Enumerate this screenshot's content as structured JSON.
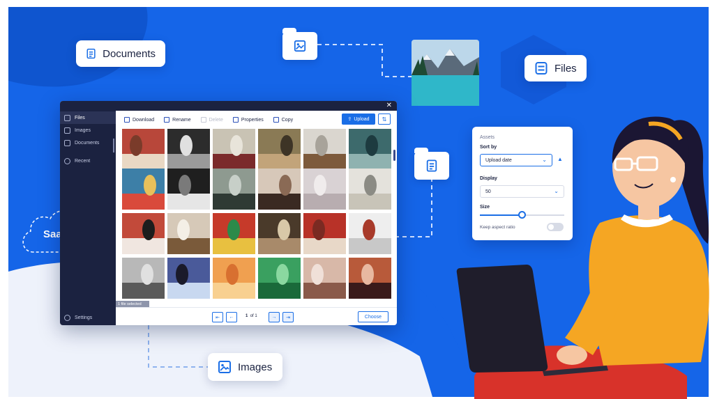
{
  "chips": {
    "documents_label": "Documents",
    "files_label": "Files",
    "images_label": "Images",
    "saas_label": "SaaS"
  },
  "window": {
    "close_glyph": "✕",
    "sidebar": {
      "items": [
        {
          "label": "Files",
          "icon": "file-list-icon"
        },
        {
          "label": "Images",
          "icon": "image-icon"
        },
        {
          "label": "Documents",
          "icon": "document-icon"
        },
        {
          "label": "Recent",
          "icon": "clock-icon"
        }
      ],
      "settings_label": "Settings"
    },
    "toolbar": {
      "download_label": "Download",
      "rename_label": "Rename",
      "delete_label": "Delete",
      "properties_label": "Properties",
      "copy_label": "Copy",
      "upload_label": "Upload"
    },
    "status": "1 file selected",
    "pagination": {
      "current_page": "1",
      "of_label": "of 1"
    },
    "choose_label": "Choose"
  },
  "assets_panel": {
    "title": "Assets",
    "sort_by_label": "Sort by",
    "sort_by_value": "Upload date",
    "display_label": "Display",
    "display_value": "50",
    "size_label": "Size",
    "size_value": 0.5,
    "aspect_label": "Keep aspect ratio",
    "aspect_on": false
  },
  "colors": {
    "brand_blue": "#1a6ee6",
    "background_blue": "#1565e8",
    "sidebar_dark": "#1b2240",
    "sweater_orange": "#f5a623"
  }
}
